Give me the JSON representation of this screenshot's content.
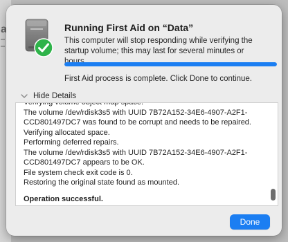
{
  "background_window": {
    "letter": "a"
  },
  "dialog": {
    "title": "Running First Aid on “Data”",
    "subtitle": "This computer will stop responding while verifying the startup volume; this may last for several minutes or hours.",
    "progress": 1.0,
    "status": "First Aid process is complete. Click Done to continue.",
    "details_toggle_label": "Hide Details",
    "log_lines": [
      {
        "text": "Verifying volume object map space.",
        "bold": false
      },
      {
        "text": "The volume /dev/rdisk3s5 with UUID 7B72A152-34E6-4907-A2F1-",
        "bold": false
      },
      {
        "text": "CCD801497DC7 was found to be corrupt and needs to be repaired.",
        "bold": false
      },
      {
        "text": "Verifying allocated space.",
        "bold": false
      },
      {
        "text": "Performing deferred repairs.",
        "bold": false
      },
      {
        "text": "The volume /dev/rdisk3s5 with UUID 7B72A152-34E6-4907-A2F1-",
        "bold": false
      },
      {
        "text": "CCD801497DC7 appears to be OK.",
        "bold": false
      },
      {
        "text": "File system check exit code is 0.",
        "bold": false
      },
      {
        "text": "Restoring the original state found as mounted.",
        "bold": false
      },
      {
        "text": "",
        "bold": false
      },
      {
        "text": "Operation successful.",
        "bold": true
      }
    ],
    "done_label": "Done"
  },
  "icons": {
    "disk": "disk-icon",
    "check": "checkmark-badge-icon",
    "chevron": "chevron-down-icon"
  },
  "colors": {
    "accent": "#1b7ef2",
    "check_green": "#2fb34a",
    "sheet_bg": "#ececec"
  }
}
